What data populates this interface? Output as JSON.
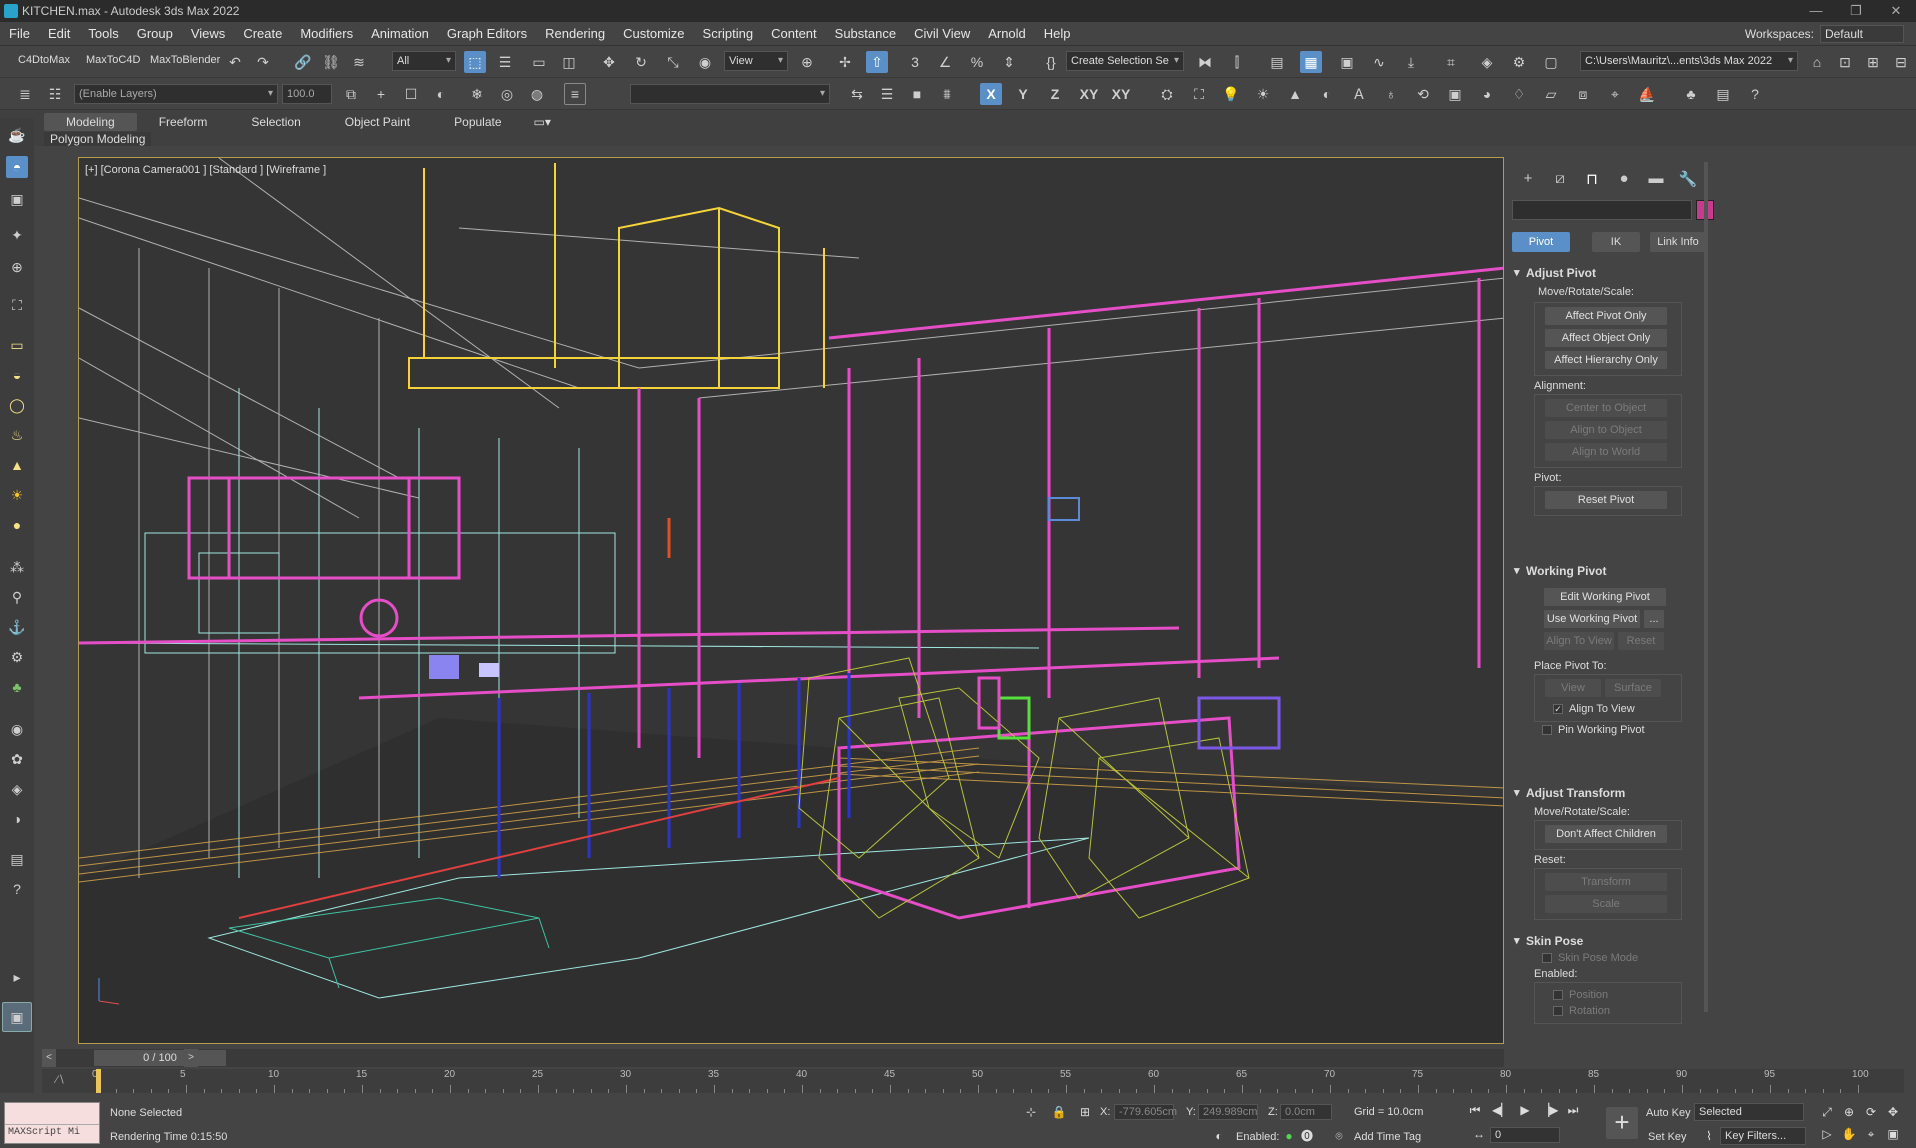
{
  "window": {
    "title": "KITCHEN.max - Autodesk 3ds Max 2022",
    "buttons": [
      "—",
      "❐",
      "✕"
    ]
  },
  "menubar": {
    "items": [
      "File",
      "Edit",
      "Tools",
      "Group",
      "Views",
      "Create",
      "Modifiers",
      "Animation",
      "Graph Editors",
      "Rendering",
      "Customize",
      "Scripting",
      "Content",
      "Substance",
      "Civil View",
      "Arnold",
      "Help"
    ],
    "workspaces_label": "Workspaces:",
    "workspaces_value": "Default"
  },
  "toolbar1": {
    "plugin_buttons": [
      "C4DtoMax",
      "MaxToC4D",
      "MaxToBlender"
    ],
    "filter_value": "All",
    "ref_coord_value": "View",
    "selection_set_placeholder": "Create Selection Se",
    "project_path": "C:\\Users\\Mauritz\\...ents\\3ds Max 2022"
  },
  "toolbar2": {
    "layer_placeholder": "(Enable Layers)",
    "layer_value": "100.0",
    "axis_labels": [
      "X",
      "Y",
      "Z",
      "XY",
      "XY"
    ]
  },
  "ribbon": {
    "tabs": [
      "Modeling",
      "Freeform",
      "Selection",
      "Object Paint",
      "Populate"
    ],
    "active_tab": "Modeling",
    "panel_label": "Polygon Modeling"
  },
  "viewport": {
    "label": "[+] [Corona Camera001 ] [Standard ] [Wireframe ]"
  },
  "command_panel": {
    "name_value": "",
    "swatch_color": "#c83a8e",
    "subtabs": [
      "Pivot",
      "IK",
      "Link Info"
    ],
    "active_subtab": "Pivot",
    "adjust_pivot": {
      "title": "Adjust Pivot",
      "move_label": "Move/Rotate/Scale:",
      "move_buttons": [
        "Affect Pivot Only",
        "Affect Object Only",
        "Affect Hierarchy Only"
      ],
      "alignment_label": "Alignment:",
      "alignment_buttons": [
        "Center to Object",
        "Align to Object",
        "Align to World"
      ],
      "pivot_label": "Pivot:",
      "reset_pivot": "Reset Pivot"
    },
    "working_pivot": {
      "title": "Working Pivot",
      "edit": "Edit Working Pivot",
      "use": "Use Working Pivot",
      "more": "...",
      "align_view": "Align To View",
      "reset": "Reset",
      "place_label": "Place Pivot To:",
      "view": "View",
      "surface": "Surface",
      "align_to_view_chk": "Align To View",
      "pin_chk": "Pin Working Pivot"
    },
    "adjust_transform": {
      "title": "Adjust Transform",
      "move_label": "Move/Rotate/Scale:",
      "dont_affect": "Don't Affect Children",
      "reset_label": "Reset:",
      "transform": "Transform",
      "scale": "Scale"
    },
    "skin_pose": {
      "title": "Skin Pose",
      "mode": "Skin Pose Mode",
      "enabled_label": "Enabled:",
      "position": "Position",
      "rotation": "Rotation"
    }
  },
  "timeslider": {
    "frame": "0 / 100",
    "prev": "<",
    "next": ">"
  },
  "trackbar": {
    "ticks": [
      "0",
      "5",
      "10",
      "15",
      "20",
      "25",
      "30",
      "35",
      "40",
      "45",
      "50",
      "55",
      "60",
      "65",
      "70",
      "75",
      "80",
      "85",
      "90",
      "95",
      "100"
    ]
  },
  "status": {
    "maxscript": "MAXScript Mi",
    "selection": "None Selected",
    "render_time": "Rendering Time  0:15:50",
    "x_label": "X:",
    "x_value": "-779.605cm",
    "y_label": "Y:",
    "y_value": "249.989cm",
    "z_label": "Z:",
    "z_value": "0.0cm",
    "grid": "Grid = 10.0cm",
    "enabled_label": "Enabled:",
    "add_time_tag": "Add Time Tag",
    "frame_value": "0",
    "auto_key": "Auto Key",
    "set_key": "Set Key",
    "key_mode": "Selected",
    "key_filters": "Key Filters..."
  }
}
